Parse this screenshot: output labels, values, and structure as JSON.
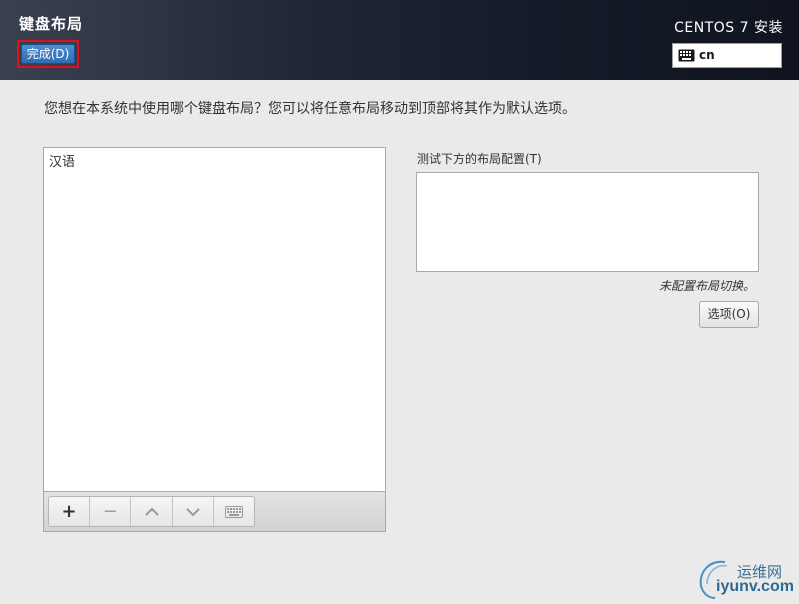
{
  "header": {
    "title": "键盘布局",
    "done_label": "完成(D)",
    "product": "CENTOS 7 安装",
    "keyboard_indicator": {
      "icon": "keyboard-icon",
      "value": "cn"
    }
  },
  "instruction": "您想在本系统中使用哪个键盘布局？您可以将任意布局移动到顶部将其作为默认选项。",
  "layouts": {
    "items": [
      "汉语"
    ],
    "toolbar": [
      {
        "icon": "plus-icon",
        "glyph": "+"
      },
      {
        "icon": "minus-icon",
        "glyph": "−"
      },
      {
        "icon": "chevron-up-icon",
        "glyph": "︿"
      },
      {
        "icon": "chevron-down-icon",
        "glyph": "﹀"
      },
      {
        "icon": "keyboard-icon",
        "glyph": ""
      }
    ]
  },
  "test_area": {
    "label": "测试下方的布局配置(T)",
    "value": ""
  },
  "switching": {
    "status": "未配置布局切换。",
    "options_label": "选项(O)"
  },
  "watermark": {
    "cn": "运维网",
    "en": "iyunv.com"
  },
  "colors": {
    "header_dark": "#141a27",
    "done_button": "#3a7bc0",
    "highlight_outline": "#e0101a"
  }
}
